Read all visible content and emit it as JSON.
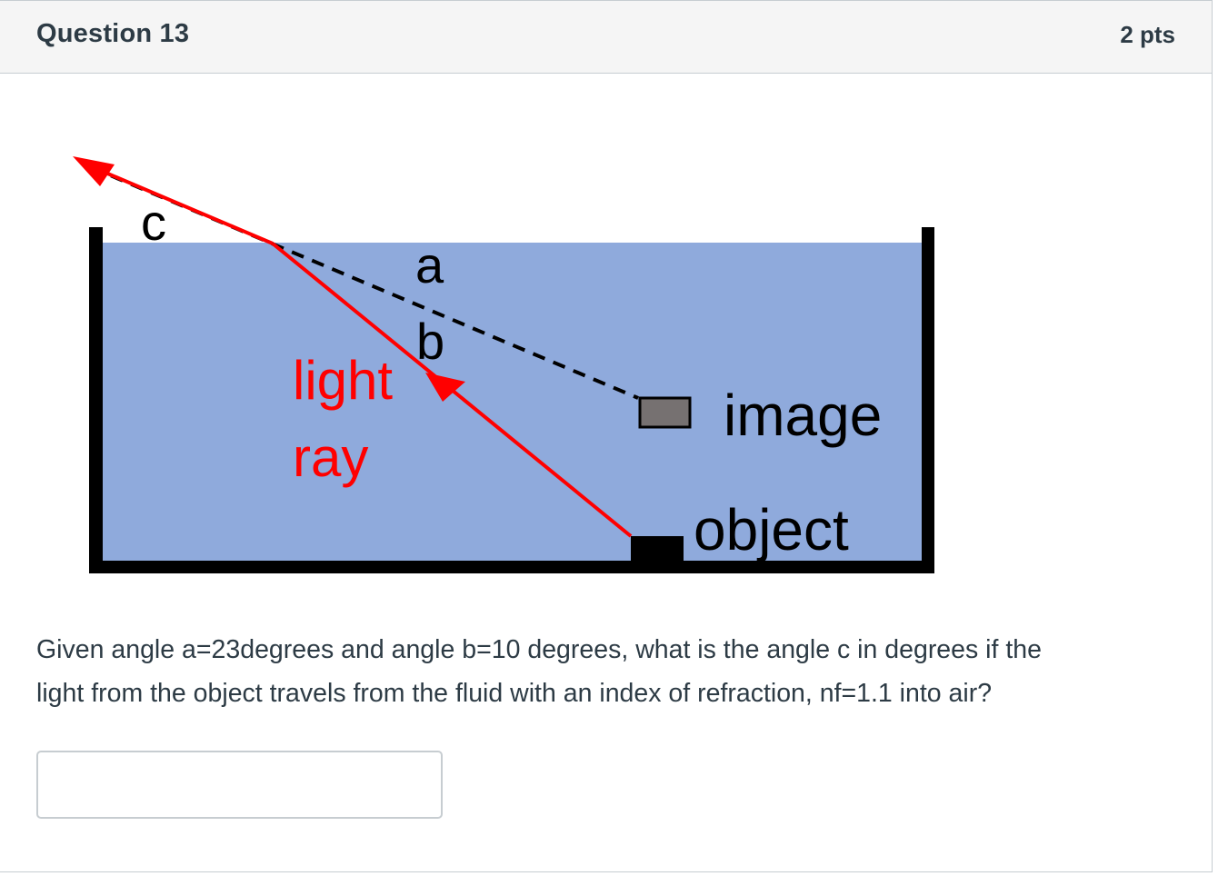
{
  "question": {
    "title": "Question 13",
    "points": "2 pts",
    "text_line1": "Given angle a=23degrees and angle b=10 degrees, what is the angle c in degrees if the",
    "text_line2": "light from the object travels from the fluid with an index of refraction, nf=1.1 into air?"
  },
  "diagram": {
    "label_c": "c",
    "label_a": "a",
    "label_b": "b",
    "label_light": "light",
    "label_ray": "ray",
    "label_image": "image",
    "label_object": "object",
    "colors": {
      "fluid": "#8faadc",
      "ray": "#ff0000",
      "tank": "#000000",
      "image_box": "#767171",
      "text": "#000000"
    }
  },
  "answer": {
    "value": "",
    "placeholder": ""
  }
}
